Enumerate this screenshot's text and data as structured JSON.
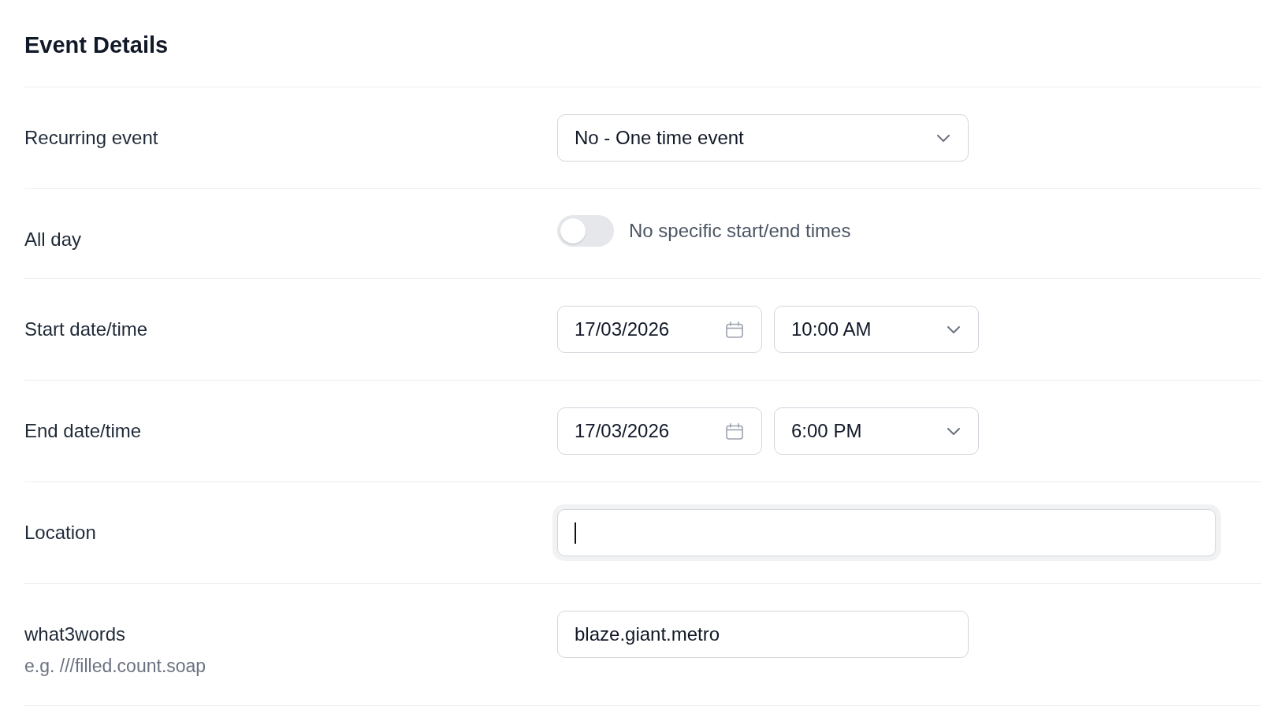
{
  "title": "Event Details",
  "fields": [
    {
      "kind": "select",
      "label": "Recurring event",
      "value": "No - One time event"
    },
    {
      "kind": "toggle",
      "label": "All day",
      "on": false,
      "caption": "No specific start/end times"
    },
    {
      "kind": "datetime",
      "label": "Start date/time",
      "date": "17/03/2026",
      "time": "10:00 AM"
    },
    {
      "kind": "datetime",
      "label": "End date/time",
      "date": "17/03/2026",
      "time": "6:00 PM"
    },
    {
      "kind": "long_text",
      "label": "Location",
      "focused": true
    },
    {
      "kind": "short_text",
      "label": "what3words",
      "hint": "e.g. ///filled.count.soap",
      "value": "blaze.giant.metro",
      "focused": false
    }
  ]
}
